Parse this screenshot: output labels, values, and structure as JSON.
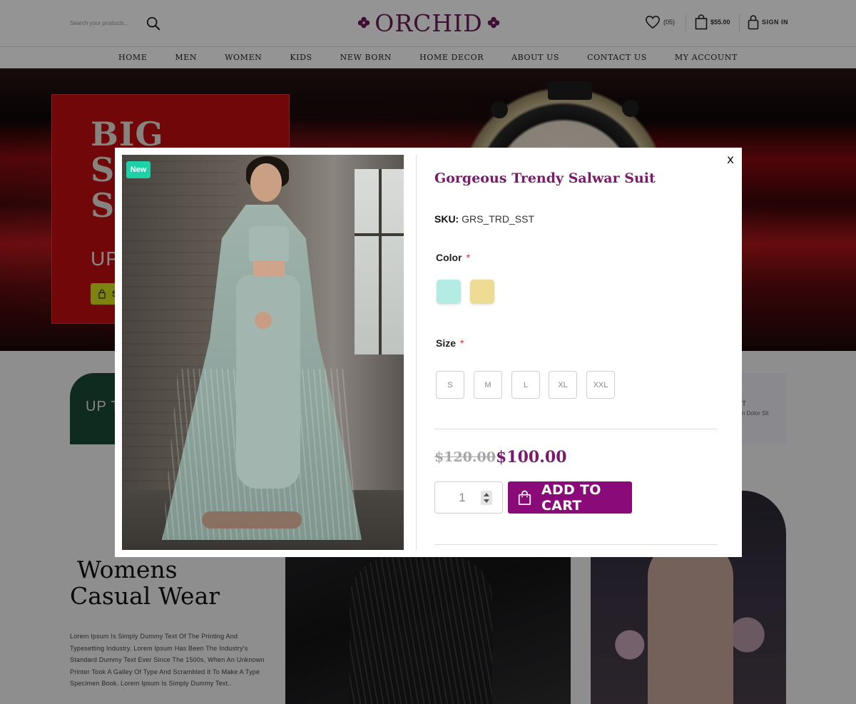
{
  "header": {
    "search_placeholder": "Search your products...",
    "logo_text": "ORCHID",
    "wishlist_count": "(05)",
    "cart_total": "$55.00",
    "signin_label": "SIGN IN"
  },
  "nav": {
    "items": [
      "HOME",
      "MEN",
      "WOMEN",
      "KIDS",
      "NEW BORN",
      "HOME DECOR",
      "ABOUT US",
      "CONTACT US",
      "MY ACCOUNT"
    ]
  },
  "hero": {
    "title_line1": "BIG",
    "title_line2": "S",
    "title_line3": "S",
    "subtitle": "UP",
    "button_label": "S"
  },
  "promo": {
    "left_text": "UP TO",
    "right_text1": "T",
    "right_text2": "n Dolor Sit"
  },
  "womens": {
    "title_line1": "Womens",
    "title_line2": "Casual Wear",
    "description": "Lorem Ipsum Is Simply Dummy Text Of The Printing And Typesetting Industry. Lorem Ipsum Has Been The Industry's Standard Dummy Text Ever Since The 1500s, When An Unknown Printer Took A Galley Of Type And Scrambled It To Make A Type Specimen Book. Lorem Ipsum Is Simply Dummy Text.."
  },
  "modal": {
    "close_label": "x",
    "badge": "New",
    "title": "Gorgeous Trendy Salwar Suit",
    "sku_label": "SKU:",
    "sku_value": "GRS_TRD_SST",
    "color_label": "Color",
    "required_mark": "*",
    "colors": [
      {
        "name": "mint",
        "hex": "#b4ece4"
      },
      {
        "name": "sand",
        "hex": "#eedb94"
      }
    ],
    "size_label": "Size",
    "sizes": [
      "S",
      "M",
      "L",
      "XL",
      "XXL"
    ],
    "old_price": "$120.00",
    "new_price": "$100.00",
    "quantity": "1",
    "add_to_cart_label": "ADD TO CART"
  },
  "colors": {
    "brand_purple": "#7a1a6c",
    "button_purple": "#8a0a7a",
    "badge_green": "#1ed2a8",
    "required_red": "#d12b2b"
  }
}
